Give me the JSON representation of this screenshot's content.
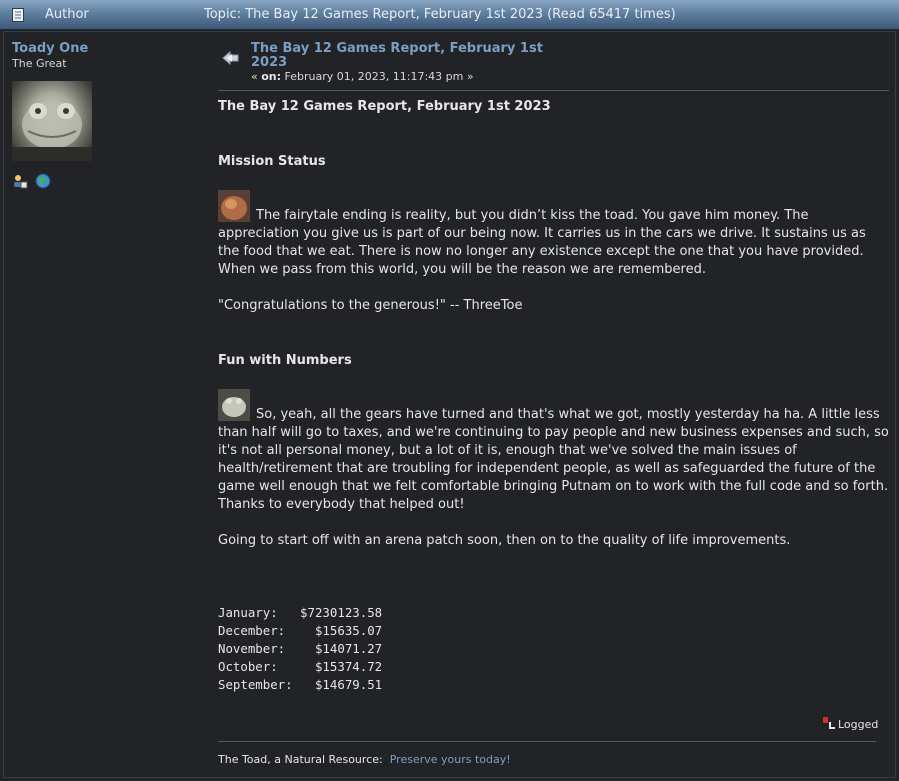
{
  "header": {
    "author_label": "Author",
    "topic_label": "Topic: The Bay 12 Games Report, February 1st 2023  (Read 65417 times)"
  },
  "poster": {
    "name": "Toady One",
    "title": "The Great",
    "icons": [
      "profile-icon",
      "website-globe-icon"
    ]
  },
  "post": {
    "subject": "The Bay 12 Games Report, February 1st 2023",
    "on_label": "on:",
    "date": "February 01, 2023, 11:17:43 pm",
    "date_prefix": "«",
    "date_suffix": "»",
    "heading": "The Bay 12 Games Report, February 1st 2023",
    "mission_title": "Mission Status",
    "mission_text": "The fairytale ending is reality, but you didn’t kiss the toad.  You gave him money.  The appreciation you give us is part of our being now.  It carries us in the cars we drive.  It sustains us as the food that we eat.  There is now no longer any existence except the one that you have provided.  When we pass from this world, you will be the reason we are remembered.",
    "quote": "\"Congratulations to the generous!\" -- ThreeToe",
    "fun_title": "Fun with Numbers",
    "fun_text": "So, yeah, all the gears have turned and that's what we got, mostly yesterday ha ha.  A little less than half will go to taxes, and we're continuing to pay people and new business expenses and such, so it's not all personal money, but a lot of it is, enough that we've solved the main issues of health/retirement that are troubling for independent people, as well as safeguarded the future of the game well enough that we felt comfortable bringing Putnam on to work with the full code and so forth.  Thanks to everybody that helped out!",
    "arena_text": "Going to start off with an arena patch soon, then on to the quality of life improvements.",
    "donations": [
      "January:   $7230123.58",
      "December:    $15635.07",
      "November:    $14071.27",
      "October:     $15374.72",
      "September:   $14679.51"
    ]
  },
  "footer": {
    "logged_label": "Logged",
    "signature_text": "The Toad, a Natural Resource:",
    "signature_link": "Preserve yours today!"
  }
}
